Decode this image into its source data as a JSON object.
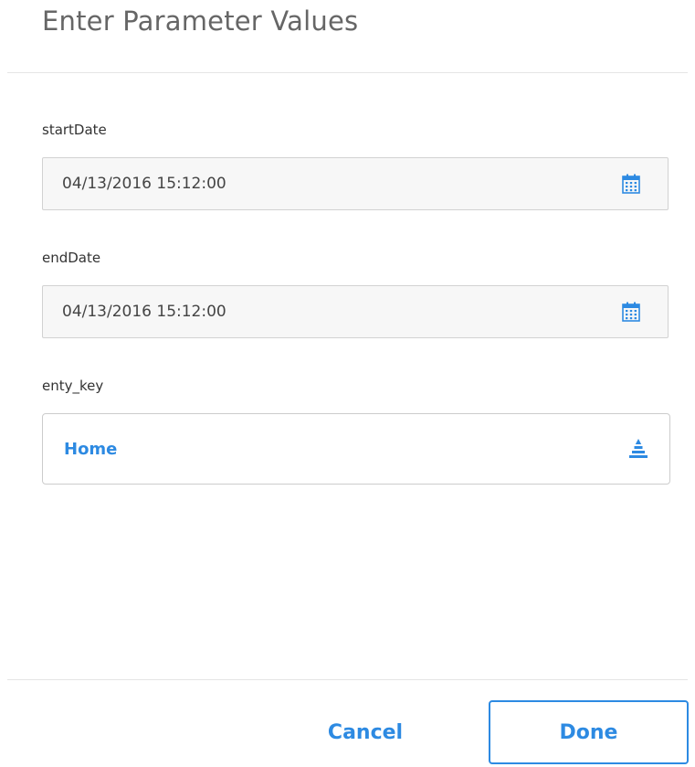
{
  "dialog": {
    "title": "Enter Parameter Values"
  },
  "params": [
    {
      "label": "startDate",
      "value": "04/13/2016 15:12:00",
      "icon": "calendar-icon"
    },
    {
      "label": "endDate",
      "value": "04/13/2016 15:12:00",
      "icon": "calendar-icon"
    },
    {
      "label": "enty_key",
      "value": "Home",
      "icon": "hierarchy-pyramid-icon"
    }
  ],
  "buttons": {
    "cancel": "Cancel",
    "done": "Done"
  },
  "colors": {
    "accent": "#2d8ae2",
    "text": "#333333",
    "title": "#666666",
    "field_bg": "#f7f7f7",
    "border": "#cfcfcf"
  }
}
